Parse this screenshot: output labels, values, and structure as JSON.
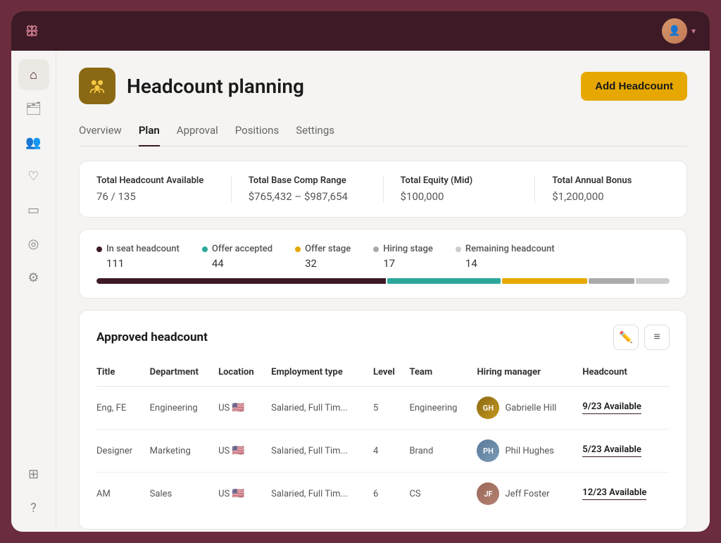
{
  "titlebar": {
    "logo": "ꕥ",
    "avatar_initials": "👤"
  },
  "sidebar": {
    "items": [
      {
        "name": "home-icon",
        "icon": "⌂"
      },
      {
        "name": "briefcase-icon",
        "icon": "💼"
      },
      {
        "name": "people-icon",
        "icon": "👥"
      },
      {
        "name": "heart-icon",
        "icon": "♡"
      },
      {
        "name": "monitor-icon",
        "icon": "▭"
      },
      {
        "name": "dollar-icon",
        "icon": "⊕"
      },
      {
        "name": "settings-icon",
        "icon": "⚙"
      },
      {
        "name": "grid-icon",
        "icon": "⊞"
      },
      {
        "name": "help-icon",
        "icon": "?"
      }
    ]
  },
  "page": {
    "title": "Headcount planning",
    "icon": "👥",
    "add_button_label": "Add Headcount"
  },
  "tabs": [
    {
      "label": "Overview",
      "active": false
    },
    {
      "label": "Plan",
      "active": true
    },
    {
      "label": "Approval",
      "active": false
    },
    {
      "label": "Positions",
      "active": false
    },
    {
      "label": "Settings",
      "active": false
    }
  ],
  "stats": [
    {
      "label": "Total Headcount Available",
      "value": "76 / 135"
    },
    {
      "label": "Total Base Comp Range",
      "value": "$765,432 – $987,654"
    },
    {
      "label": "Total Equity (Mid)",
      "value": "$100,000"
    },
    {
      "label": "Total Annual Bonus",
      "value": "$1,200,000"
    }
  ],
  "headcount_bar": {
    "legend": [
      {
        "label": "In seat headcount",
        "color": "#3d1a26",
        "value": "111",
        "width": 51
      },
      {
        "label": "Offer accepted",
        "color": "#2ba89a",
        "value": "44",
        "width": 20
      },
      {
        "label": "Offer stage",
        "color": "#e6a800",
        "value": "32",
        "width": 15
      },
      {
        "label": "Hiring stage",
        "color": "#aaa",
        "value": "17",
        "width": 8
      },
      {
        "label": "Remaining headcount",
        "color": "#ccc",
        "value": "14",
        "width": 6
      }
    ]
  },
  "approved_headcount": {
    "title": "Approved headcount",
    "columns": [
      "Title",
      "Department",
      "Location",
      "Employment type",
      "Level",
      "Team",
      "Hiring manager",
      "Headcount"
    ],
    "rows": [
      {
        "title": "Eng, FE",
        "department": "Engineering",
        "location": "US 🇺🇸",
        "employment_type": "Salaried, Full Tim...",
        "level": "5",
        "team": "Engineering",
        "manager": "Gabrielle Hill",
        "manager_initials": "GH",
        "headcount": "9/23 Available"
      },
      {
        "title": "Designer",
        "department": "Marketing",
        "location": "US 🇺🇸",
        "employment_type": "Salaried, Full Tim...",
        "level": "4",
        "team": "Brand",
        "manager": "Phil Hughes",
        "manager_initials": "PH",
        "headcount": "5/23 Available"
      },
      {
        "title": "AM",
        "department": "Sales",
        "location": "US 🇺🇸",
        "employment_type": "Salaried, Full Tim...",
        "level": "6",
        "team": "CS",
        "manager": "Jeff Foster",
        "manager_initials": "JF",
        "headcount": "12/23 Available"
      }
    ]
  }
}
